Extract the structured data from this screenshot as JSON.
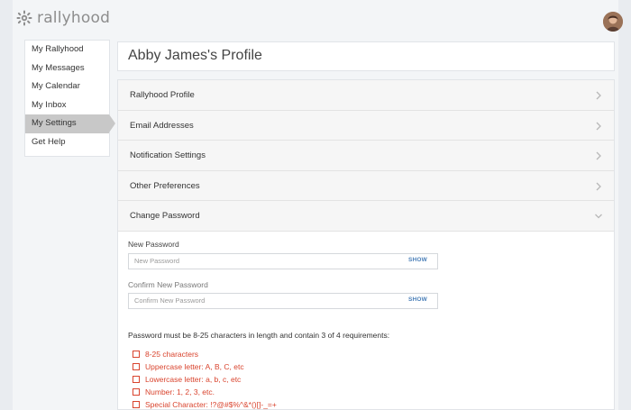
{
  "header": {
    "logo_text": "rallyhood",
    "brand_gray": "#8d8d8d"
  },
  "sidebar": {
    "items": [
      {
        "label": "My Rallyhood"
      },
      {
        "label": "My Messages"
      },
      {
        "label": "My Calendar"
      },
      {
        "label": "My Inbox"
      },
      {
        "label": "My Settings",
        "active": true
      },
      {
        "label": "Get Help"
      }
    ]
  },
  "profile": {
    "title": "Abby James's Profile"
  },
  "sections": [
    {
      "label": "Rallyhood Profile",
      "icon": "chevron-right-icon"
    },
    {
      "label": "Email Addresses",
      "icon": "chevron-right-icon"
    },
    {
      "label": "Notification Settings",
      "icon": "chevron-right-icon"
    },
    {
      "label": "Other Preferences",
      "icon": "chevron-right-icon"
    },
    {
      "label": "Change Password",
      "icon": "chevron-down-icon",
      "expanded": true
    }
  ],
  "password": {
    "new_label": "New Password",
    "new_placeholder": "New Password",
    "confirm_label": "Confirm New Password",
    "confirm_placeholder": "Confirm New Password",
    "show_label": "SHOW",
    "requirements_intro": "Password must be 8-25 characters in length and contain 3 of 4 requirements:",
    "requirements": [
      "8-25 characters",
      "Uppercase letter: A, B, C, etc",
      "Lowercase letter: a, b, c, etc",
      "Number: 1, 2, 3, etc.",
      "Special Character: !?@#$%^&*()[]-_=+"
    ]
  },
  "colors": {
    "requirement_red": "#d9442e",
    "show_blue": "#4a7fb8",
    "active_nav": "#c8c8c8"
  }
}
